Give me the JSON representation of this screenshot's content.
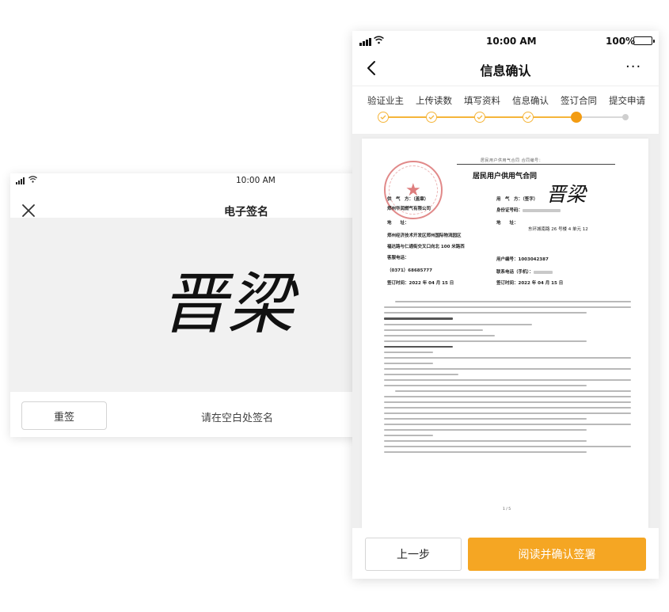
{
  "left_screen": {
    "status_time": "10:00 AM",
    "title": "电子签名",
    "reset_button": "重签",
    "hint": "请在空白处签名",
    "signature_text": "晋梁"
  },
  "right_screen": {
    "status_time": "10:00 AM",
    "battery": "100%",
    "title": "信息确认",
    "more": "···",
    "steps": [
      {
        "label": "验证业主",
        "status": "done"
      },
      {
        "label": "上传读数",
        "status": "done"
      },
      {
        "label": "填写资料",
        "status": "done"
      },
      {
        "label": "信息确认",
        "status": "done"
      },
      {
        "label": "签订合同",
        "status": "current"
      },
      {
        "label": "提交申请",
        "status": "pending"
      }
    ],
    "document": {
      "header": "居民用户供用气合同        合同编号：",
      "title": "居民用户供用气合同",
      "fields": {
        "supplier_label": "供　气　方：（盖章）",
        "supplier_value": "郑州华润燃气有限公司",
        "consumer_label": "用　气　方：（签字）",
        "id_label": "身份证号码：",
        "address_label_left": "地　　址：",
        "address_label_right": "地　　址：",
        "address_right": "东环城南路 26 号楼 4 单元 12",
        "supplier_address_1": "郑州经济技术开发区郑州国际物流园区",
        "supplier_address_2": "福达路与仁通街交叉口向北 100 米路西",
        "service_label": "客服电话：",
        "user_no_label": "用户编号：",
        "user_no_value": "1003042387",
        "service_phone": "（0371）68685777",
        "contact_label": "联系电话（手机）：",
        "sign_time_left": "签订时间：2022 年 04 月 15 日",
        "sign_time_right": "签订时间：2022 年 04 月 15 日"
      },
      "signature_text": "晋梁",
      "page_number": "1 / 5"
    },
    "prev_button": "上一步",
    "confirm_button": "阅读并确认签署"
  },
  "colors": {
    "accent": "#f5a623",
    "step_line": "#f5b53a",
    "seal": "#c82828"
  }
}
